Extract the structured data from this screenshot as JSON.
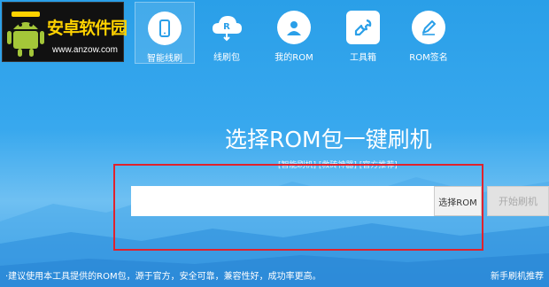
{
  "brand": {
    "name": "安卓软件园",
    "url": "www.anzow.com",
    "name_color": "#ffd200"
  },
  "nav": {
    "items": [
      {
        "label": "智能线刷",
        "icon": "phone-icon",
        "active": true
      },
      {
        "label": "线刷包",
        "icon": "cloud-r-icon",
        "active": false
      },
      {
        "label": "我的ROM",
        "icon": "user-icon",
        "active": false
      },
      {
        "label": "工具箱",
        "icon": "wrench-icon",
        "active": false
      },
      {
        "label": "ROM签名",
        "icon": "pen-icon",
        "active": false
      }
    ]
  },
  "main": {
    "headline": "选择ROM包一键刷机",
    "tags": "[智能刷机] [救砖神器] [官方推荐]",
    "path_input_value": "",
    "choose_button": "选择ROM",
    "start_button": "开始刷机"
  },
  "footer": {
    "notice": "·建议使用本工具提供的ROM包，源于官方，安全可靠，兼容性好，成功率更高。",
    "right_link": "新手刷机推荐 "
  },
  "colors": {
    "background": "#2a9fe8",
    "highlight_box": "#e0222d"
  }
}
